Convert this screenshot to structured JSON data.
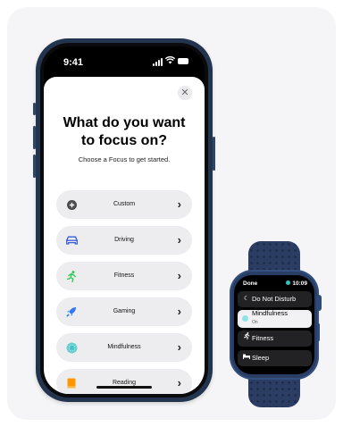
{
  "phone": {
    "status_time": "9:41",
    "sheet": {
      "close_icon": "xmark",
      "title": "What do you want\nto focus on?",
      "subtitle": "Choose a Focus to get started.",
      "options": [
        {
          "label": "Custom",
          "icon": "plus-circle-icon",
          "color": "#4a4a4f"
        },
        {
          "label": "Driving",
          "icon": "car-icon",
          "color": "#3b5bd6"
        },
        {
          "label": "Fitness",
          "icon": "running-figure-icon",
          "color": "#34c759"
        },
        {
          "label": "Gaming",
          "icon": "rocket-icon",
          "color": "#3478f6"
        },
        {
          "label": "Mindfulness",
          "icon": "flower-icon",
          "color": "#3ec6c6"
        },
        {
          "label": "Reading",
          "icon": "book-icon",
          "color": "#ff9500"
        }
      ],
      "chevron": "›"
    }
  },
  "watch": {
    "done_label": "Done",
    "time": "10:09",
    "dot_color": "#2ec4c4",
    "items": [
      {
        "label": "Do Not Disturb",
        "icon": "moon-icon",
        "glyph": "☾"
      },
      {
        "label": "Mindfulness",
        "sublabel": "On",
        "icon": "flower-icon",
        "selected": true
      },
      {
        "label": "Fitness",
        "icon": "running-figure-icon",
        "glyph": "🏃"
      },
      {
        "label": "Sleep",
        "icon": "bed-icon",
        "glyph": "▬"
      }
    ]
  }
}
